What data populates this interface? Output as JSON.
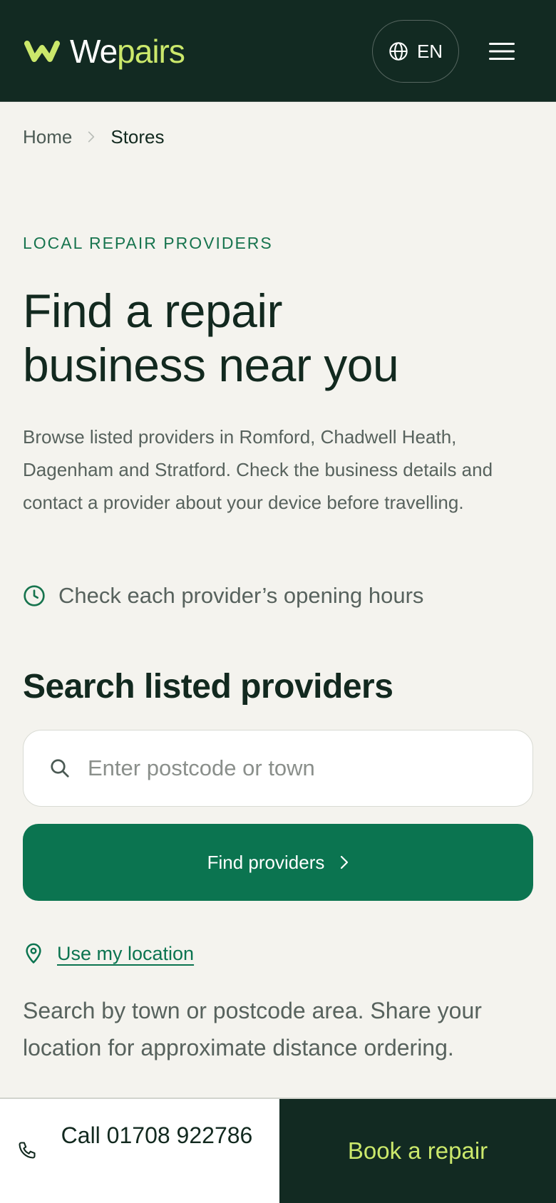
{
  "header": {
    "logo": {
      "text_part1": "We",
      "text_part2": "pairs"
    },
    "language": {
      "label": "EN",
      "icon": "globe-icon"
    },
    "menu": {
      "icon": "hamburger-menu-icon"
    }
  },
  "breadcrumb": {
    "items": [
      "Home",
      "Stores"
    ],
    "separator_icon": "chevron-right-icon"
  },
  "hero": {
    "eyebrow": "LOCAL REPAIR PROVIDERS",
    "title_line1": "Find a repair",
    "title_line2": "business near you",
    "description": "Browse listed providers in Romford, Chadwell Heath, Dagenham and Stratford. Check the business details and contact a provider about your device before travelling.",
    "hours_note": "Check each provider’s opening hours",
    "hours_icon": "clock-icon"
  },
  "search": {
    "heading": "Search listed providers",
    "input_value": "",
    "placeholder": "Enter postcode or town",
    "search_icon": "search-icon",
    "button_label": "Find providers",
    "use_location_label": "Use my location",
    "location_icon": "map-pin-icon",
    "help_text": "Search by town or postcode area. Share your location for approximate distance ordering."
  },
  "bottom_bar": {
    "call_label": "Call 01708 922786",
    "call_icon": "phone-icon",
    "book_label": "Book a repair"
  },
  "colors": {
    "header_bg": "#122a22",
    "brand_lime": "#cbe86b",
    "primary_green": "#0b7450",
    "page_bg": "#f4f3ee",
    "text_dark": "#12291f",
    "text_muted": "#57625d"
  }
}
